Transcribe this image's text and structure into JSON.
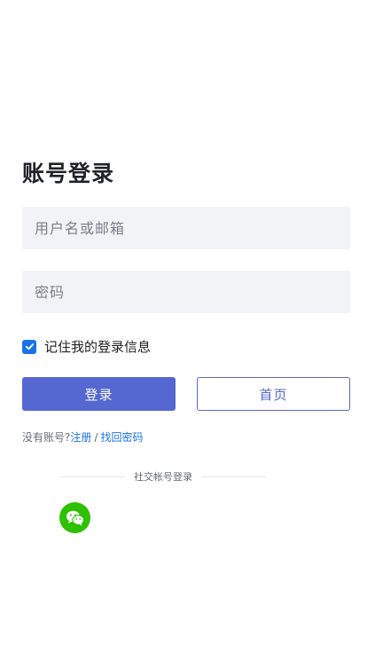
{
  "login": {
    "title": "账号登录",
    "username_placeholder": "用户名或邮箱",
    "password_placeholder": "密码",
    "remember_label": "记住我的登录信息",
    "remember_checked": true,
    "login_button": "登录",
    "home_button": "首页"
  },
  "links": {
    "prefix": "没有账号?",
    "register": "注册",
    "separator": "/",
    "forgot": "找回密码"
  },
  "social": {
    "divider_label": "社交帐号登录",
    "providers": [
      {
        "icon": "wechat-icon",
        "color": "#2dc100"
      }
    ]
  },
  "colors": {
    "primary": "#5567d0",
    "link": "#1a73e8",
    "input_bg": "#f2f3f7"
  }
}
